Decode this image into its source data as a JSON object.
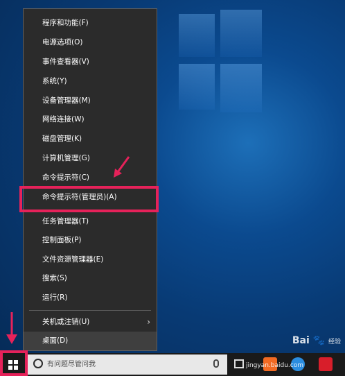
{
  "menu": {
    "items": [
      {
        "label": "程序和功能(F)"
      },
      {
        "label": "电源选项(O)"
      },
      {
        "label": "事件查看器(V)"
      },
      {
        "label": "系统(Y)"
      },
      {
        "label": "设备管理器(M)"
      },
      {
        "label": "网络连接(W)"
      },
      {
        "label": "磁盘管理(K)"
      },
      {
        "label": "计算机管理(G)"
      },
      {
        "label": "命令提示符(C)"
      },
      {
        "label": "命令提示符(管理员)(A)"
      },
      {
        "label": "任务管理器(T)"
      },
      {
        "label": "控制面板(P)"
      },
      {
        "label": "文件资源管理器(E)"
      },
      {
        "label": "搜索(S)"
      },
      {
        "label": "运行(R)"
      },
      {
        "label": "关机或注销(U)"
      },
      {
        "label": "桌面(D)"
      }
    ],
    "submenu_arrow": "›"
  },
  "taskbar": {
    "search_placeholder": "有问题尽管问我",
    "icons": [
      "windows-start-icon",
      "cortana-icon",
      "microphone-icon",
      "task-view-icon",
      "app-icon-orange",
      "app-icon-blue",
      "app-icon-red"
    ]
  },
  "watermark": {
    "brand": "Bai",
    "suffix": "经验",
    "url": "jingyan.baidu.com"
  },
  "colors": {
    "highlight": "#e6225a",
    "menu_bg": "#2b2b2b",
    "taskbar_bg": "#1a1a1a"
  }
}
